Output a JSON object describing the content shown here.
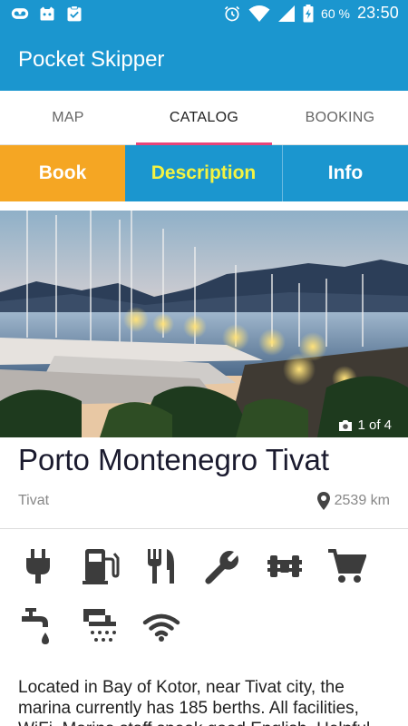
{
  "status_bar": {
    "battery": "60 %",
    "time": "23:50",
    "icons": [
      "voicemail-icon",
      "cat-app-icon",
      "clipboard-check-icon",
      "alarm-icon",
      "wifi-icon",
      "signal-icon",
      "battery-charging-icon"
    ]
  },
  "app_bar": {
    "title": "Pocket Skipper"
  },
  "tabs": [
    {
      "label": "MAP",
      "active": false
    },
    {
      "label": "CATALOG",
      "active": true
    },
    {
      "label": "BOOKING",
      "active": false
    }
  ],
  "sub_tabs": {
    "book": "Book",
    "description": "Description",
    "info": "Info"
  },
  "hero": {
    "counter": "1 of 4",
    "icon": "camera-icon"
  },
  "marina": {
    "name": "Porto Montenegro Tivat",
    "location": "Tivat",
    "distance": "2539 km"
  },
  "amenities": [
    "electricity-plug-icon",
    "fuel-pump-icon",
    "restaurant-icon",
    "repair-wrench-icon",
    "mooring-bollard-icon",
    "shopping-cart-icon",
    "water-tap-icon",
    "shower-icon",
    "wifi-icon"
  ],
  "description": "Located in Bay of Kotor, near Tivat city, the marina currently has 185 berths. All facilities, WiFi, Marina staff speak good English. Helpful",
  "colors": {
    "primary": "#1b96cf",
    "tab_indicator": "#e8457a",
    "book_tab": "#f5a623",
    "description_tab_text": "#f4f341"
  }
}
